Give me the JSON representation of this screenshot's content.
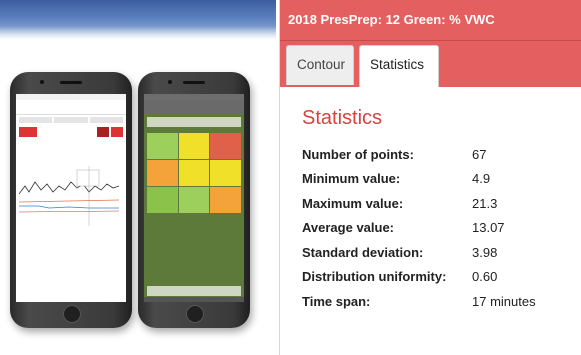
{
  "panel": {
    "title": "2018 PresPrep: 12 Green: % VWC",
    "tabs": [
      {
        "label": "Contour",
        "active": false
      },
      {
        "label": "Statistics",
        "active": true
      }
    ],
    "heading": "Statistics",
    "stats": [
      {
        "label": "Number of points:",
        "value": "67"
      },
      {
        "label": "Minimum value:",
        "value": "4.9"
      },
      {
        "label": "Maximum value:",
        "value": "21.3"
      },
      {
        "label": "Average value:",
        "value": "13.07"
      },
      {
        "label": "Standard deviation:",
        "value": "3.98"
      },
      {
        "label": "Distribution uniformity:",
        "value": "0.60"
      },
      {
        "label": "Time span:",
        "value": "17 minutes"
      }
    ]
  },
  "colors": {
    "header_bg": "#e45f5f",
    "heading_text": "#d8423d"
  },
  "icons": {
    "phone_one": "smartphone-soil-moisture-graph-report",
    "phone_two": "smartphone-course-moisture-grid"
  }
}
